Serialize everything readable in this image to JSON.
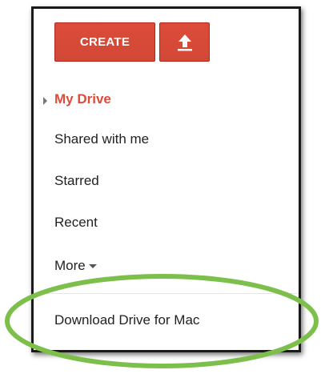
{
  "toolbar": {
    "create_label": "CREATE",
    "upload_icon": "upload-arrow-icon"
  },
  "nav": {
    "items": [
      {
        "label": "My Drive",
        "active": true
      },
      {
        "label": "Shared with me",
        "active": false
      },
      {
        "label": "Starred",
        "active": false
      },
      {
        "label": "Recent",
        "active": false
      },
      {
        "label": "More",
        "active": false
      }
    ]
  },
  "download_link": {
    "label": "Download Drive for Mac"
  },
  "colors": {
    "accent": "#dd4b39",
    "highlight_ring": "#7cbf4a",
    "text": "#222222"
  }
}
